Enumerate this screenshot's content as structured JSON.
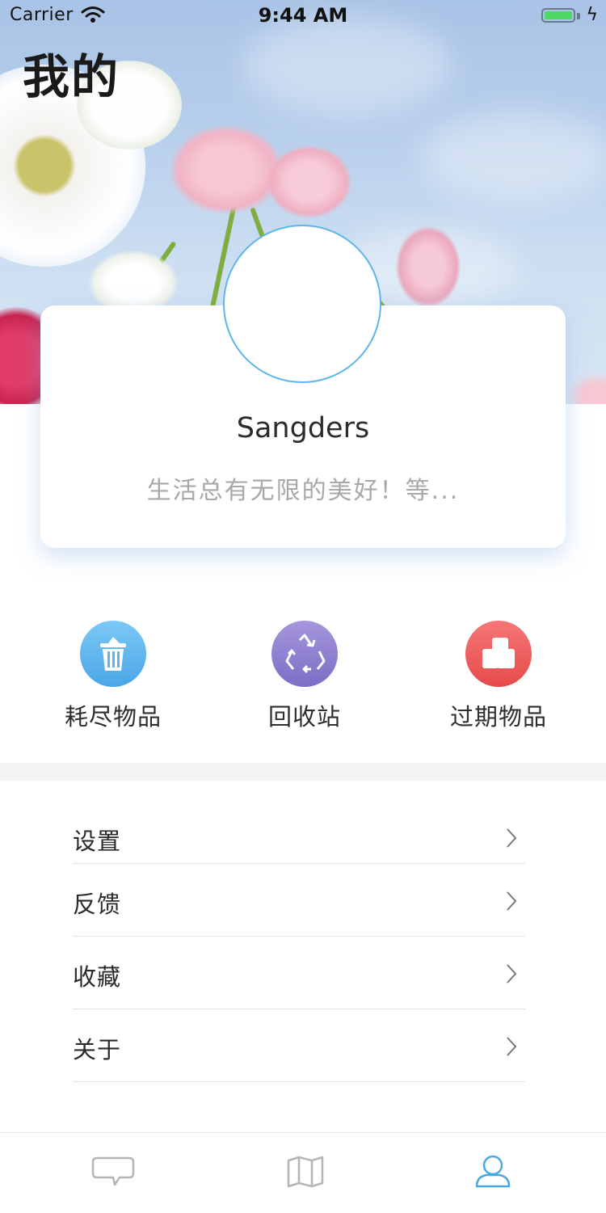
{
  "status_bar": {
    "carrier": "Carrier",
    "time": "9:44 AM",
    "battery_icon": "battery-icon",
    "wifi_icon": "wifi-icon"
  },
  "header": {
    "title": "我的"
  },
  "profile": {
    "username": "Sangders",
    "motto": "生活总有无限的美好！等..."
  },
  "actions": [
    {
      "label": "耗尽物品",
      "icon": "trash-icon",
      "color": "#5db3ee"
    },
    {
      "label": "回收站",
      "icon": "recycle-icon",
      "color": "#8b7ccf"
    },
    {
      "label": "过期物品",
      "icon": "box-icon",
      "color": "#ef5a5a"
    }
  ],
  "menu": [
    {
      "label": "设置"
    },
    {
      "label": "反馈"
    },
    {
      "label": "收藏"
    },
    {
      "label": "关于"
    }
  ],
  "tabbar": {
    "tabs": [
      {
        "icon": "message-icon",
        "active": false
      },
      {
        "icon": "map-icon",
        "active": false
      },
      {
        "icon": "profile-icon",
        "active": true
      }
    ],
    "active_color": "#4aa8e0",
    "inactive_color": "#b5b5b5"
  }
}
